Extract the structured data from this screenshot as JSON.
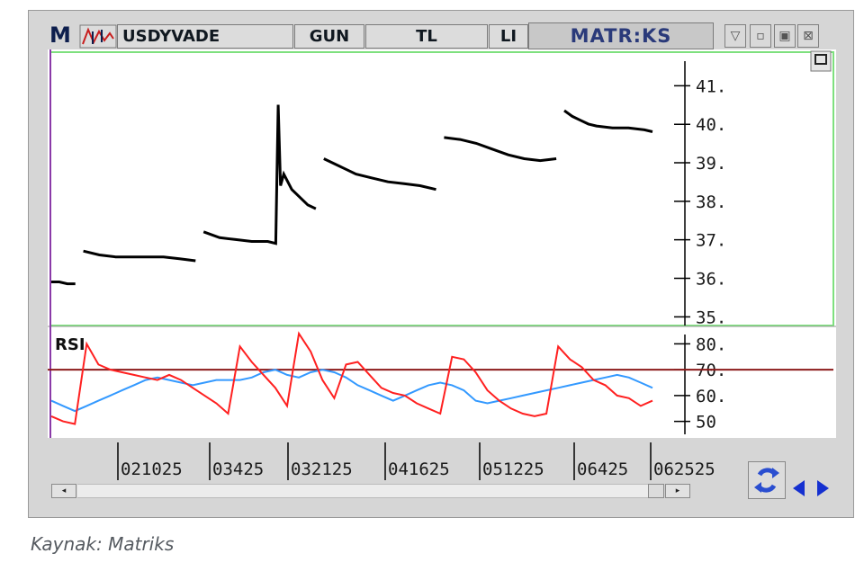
{
  "window": {
    "logo": "M",
    "symbol": "USDYVADE",
    "tabs": [
      "GUN",
      "TL",
      "LI"
    ],
    "brand": "MATR:KS",
    "buttons": [
      "▽",
      "▫",
      "▣",
      "⊠"
    ]
  },
  "price_pane": {
    "y_ticks": [
      "41.",
      "40.",
      "39.",
      "38.",
      "37.",
      "36.",
      "35."
    ],
    "colors": {
      "border": "#7ee07e",
      "price": "#000000"
    }
  },
  "rsi_pane": {
    "label": "RSI",
    "y_ticks": [
      "80.",
      "70.",
      "60.",
      "50"
    ],
    "colors": {
      "rsi": "#ff2020",
      "signal": "#3399ff",
      "level": "#8b1a1a"
    }
  },
  "date_axis": [
    "021025",
    "03425",
    "032125",
    "041625",
    "051225",
    "06425",
    "062525"
  ],
  "caption": "Kaynak: Matriks",
  "chart_data": {
    "type": "line",
    "series": [
      {
        "name": "price",
        "segments": [
          {
            "x": [
              0,
              1,
              2,
              3
            ],
            "y": [
              36.0,
              36.0,
              35.95,
              35.95
            ]
          },
          {
            "x": [
              4,
              6,
              8,
              10,
              12,
              14,
              16,
              18
            ],
            "y": [
              36.8,
              36.7,
              36.65,
              36.65,
              36.65,
              36.65,
              36.6,
              36.55
            ]
          },
          {
            "x": [
              19,
              21,
              23,
              25,
              27,
              28,
              28.3,
              28.6,
              29,
              30,
              31,
              32,
              33
            ],
            "y": [
              37.3,
              37.15,
              37.1,
              37.05,
              37.05,
              37.0,
              40.6,
              38.5,
              38.8,
              38.4,
              38.2,
              38.0,
              37.9
            ]
          },
          {
            "x": [
              34,
              36,
              38,
              40,
              42,
              44,
              46,
              48
            ],
            "y": [
              39.2,
              39.0,
              38.8,
              38.7,
              38.6,
              38.55,
              38.5,
              38.4
            ]
          },
          {
            "x": [
              49,
              51,
              53,
              55,
              57,
              59,
              61,
              63
            ],
            "y": [
              39.75,
              39.7,
              39.6,
              39.45,
              39.3,
              39.2,
              39.15,
              39.2
            ]
          },
          {
            "x": [
              64,
              65,
              66,
              67,
              68,
              70,
              72,
              74,
              75
            ],
            "y": [
              40.45,
              40.3,
              40.2,
              40.1,
              40.05,
              40.0,
              40.0,
              39.95,
              39.9
            ]
          }
        ]
      }
    ],
    "ylim": [
      35,
      41.5
    ],
    "rsi": {
      "ylim": [
        45,
        85
      ],
      "level": 70,
      "rsi_values": [
        52,
        50,
        49,
        80,
        72,
        70,
        69,
        68,
        67,
        66,
        68,
        66,
        63,
        60,
        57,
        53,
        79,
        73,
        68,
        63,
        56,
        84,
        77,
        66,
        59,
        72,
        73,
        68,
        63,
        61,
        60,
        57,
        55,
        53,
        75,
        74,
        69,
        62,
        58,
        55,
        53,
        52,
        53,
        79,
        74,
        71,
        66,
        64,
        60,
        59,
        56,
        58
      ],
      "signal_values": [
        58,
        56,
        54,
        56,
        58,
        60,
        62,
        64,
        66,
        67,
        66,
        65,
        64,
        65,
        66,
        66,
        66,
        67,
        69,
        70,
        68,
        67,
        69,
        70,
        69,
        67,
        64,
        62,
        60,
        58,
        60,
        62,
        64,
        65,
        64,
        62,
        58,
        57,
        58,
        59,
        60,
        61,
        62,
        63,
        64,
        65,
        66,
        67,
        68,
        67,
        65,
        63
      ]
    }
  }
}
